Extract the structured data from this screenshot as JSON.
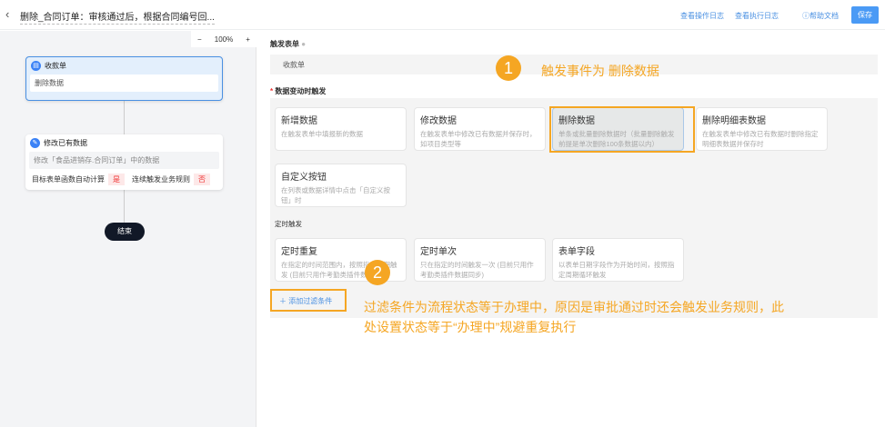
{
  "header": {
    "title": "删除_合同订单：审核通过后，根据合同编号回...",
    "links": [
      "查看操作日志",
      "查看执行日志",
      "帮助文档"
    ],
    "save": "保存"
  },
  "canvas": {
    "zoom": "100%",
    "minus": "−",
    "plus": "+",
    "node1": {
      "title": "收款单",
      "body": "删除数据"
    },
    "node2": {
      "title": "修改已有数据",
      "body": "修改「食品进销存.合同订单」中的数据",
      "calc_label": "目标表单函数自动计算",
      "calc_value": "是",
      "chain_label": "连续触发业务规则",
      "chain_value": "否"
    },
    "end": "结束"
  },
  "form": {
    "trigger_form_label": "触发表单",
    "trigger_form_value": "收款单",
    "data_change_label": "数据变动时触发",
    "timer_label": "定时触发",
    "cards": [
      {
        "title": "新增数据",
        "desc": "在触发表单中填报新的数据"
      },
      {
        "title": "修改数据",
        "desc": "在触发表单中修改已有数据并保存时，如项目类型等"
      },
      {
        "title": "删除数据",
        "desc": "单条或批量删除数据时（批量删除触发前提是单次删除100条数据以内）"
      },
      {
        "title": "删除明细表数据",
        "desc": "在触发表单中修改已有数据时删除指定明细表数据并保存时"
      },
      {
        "title": "自定义按钮",
        "desc": "在列表或数据详情中点击「自定义按钮」时"
      }
    ],
    "timer_cards": [
      {
        "title": "定时重复",
        "desc": "在指定的时间范围内，按照指定周期触发 (目前只用作考勤类插件数据同步)"
      },
      {
        "title": "定时单次",
        "desc": "只在指定的时间触发一次 (目前只用作考勤类插件数据同步)"
      },
      {
        "title": "表单字段",
        "desc": "以表单日期字段作为开始时间，按照指定周期循环触发"
      }
    ],
    "add_filter": "添加过滤条件"
  },
  "annotations": {
    "n1": "1",
    "note1": "触发事件为 删除数据",
    "n2": "2",
    "note2": "过滤条件为流程状态等于办理中，原因是审批通过时还会触发业务规则，此处设置状态等于“办理中”规避重复执行"
  },
  "colors": {
    "accent": "#4a90e2",
    "annotation": "#f5a623"
  }
}
